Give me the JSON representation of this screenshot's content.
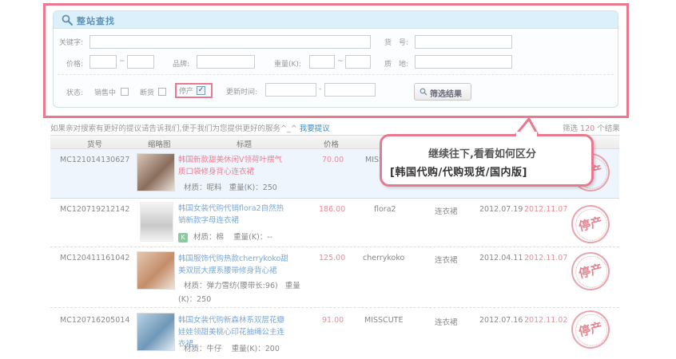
{
  "panel": {
    "title": "整站查找"
  },
  "form": {
    "keyword_label": "关键字:",
    "item_no_label": "货　号:",
    "price_label": "价格:",
    "price_sep": "~",
    "brand_label": "品牌:",
    "weight_label": "重量(K):",
    "weight_sep": "~",
    "material_label": "质　地:",
    "status_label": "状态:",
    "status_on_sale": "销售中",
    "status_new": "断货",
    "status_stopped": "停产",
    "update_time_label": "更新时间:",
    "date_sep": "-",
    "filter_button": "筛选结果"
  },
  "notice": {
    "text": "如果亲对搜索有更好的提议请告诉我们,便于我们为您提供更好的服务^_^",
    "link": "我要提议"
  },
  "count": {
    "prefix": "筛选",
    "number": "120",
    "suffix": "个结果"
  },
  "table": {
    "headers": {
      "code": "货号",
      "thumb": "缩略图",
      "title": "标题",
      "price": "价格"
    },
    "rows": [
      {
        "code": "MC121014130627",
        "title": "韩国新款甜美休闲V领荷叶摆气质口袋修身背心连衣裙",
        "material": "材质：呢料",
        "weight": "重量(K)：250",
        "price": "70.00",
        "brand": "MISS",
        "stamp": "停产"
      },
      {
        "code": "MC120719212142",
        "title": "韩国女装代购代销flora2自然热销新款字母连衣裙",
        "material": "材质：棉",
        "weight": "重量(K)：--",
        "badge": "K",
        "price": "186.00",
        "brand": "flora2",
        "category": "连衣裙",
        "date1": "2012.07.19",
        "date2": "2012.11.07",
        "stamp": "停产"
      },
      {
        "code": "MC120411161042",
        "title": "韩国服饰代购热款cherrykoko甜美双层大摆系腰带修身背心裙",
        "material": "材质：弹力雪纺(腰带长:96)",
        "weight_a": "重量",
        "weight_b": "(K)：250",
        "price": "125.00",
        "brand": "cherrykoko",
        "category": "连衣裙",
        "date1": "2012.04.11",
        "date2": "2012.11.07",
        "stamp": "停产"
      },
      {
        "code": "MC120716205014",
        "title": "韩国女装代购新森林系双层花瓣娃娃领甜美桃心印花抽绳公主连衣裙",
        "material": "材质：牛仔",
        "weight": "重量(K)：200",
        "price": "91.00",
        "brand": "MISSCUTE",
        "category": "连衣裙",
        "date1": "2012.07.16",
        "date2": "2012.11.02",
        "stamp": "停产"
      }
    ]
  },
  "callout": {
    "line1": "继续往下,看看如何区分",
    "line2": "[韩国代购/代购现货/国内版]"
  },
  "colors": {
    "highlight": "#e8798f",
    "link": "#3a8ccc",
    "price": "#ef8b99"
  }
}
